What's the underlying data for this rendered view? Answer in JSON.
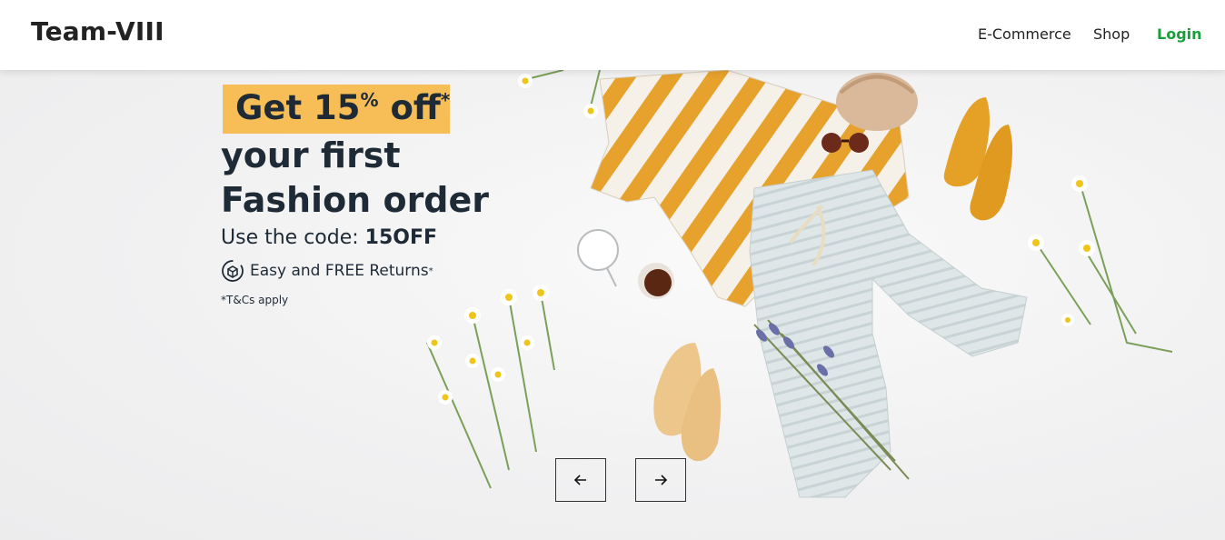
{
  "navbar": {
    "brand": "Team-VIII",
    "links": [
      {
        "label": "E-Commerce"
      },
      {
        "label": "Shop"
      },
      {
        "label": "Login"
      }
    ]
  },
  "hero": {
    "promo_prefix": "Get 15",
    "promo_percent": "%",
    "promo_suffix": " off",
    "promo_star": "*",
    "line2": "your first",
    "line3": "Fashion order",
    "code_prefix": "Use the code: ",
    "code": "15OFF",
    "returns_text": "Easy and FREE Returns",
    "returns_star": "*",
    "terms": "*T&Cs apply",
    "returns_icon": "returns-box-icon"
  },
  "carousel": {
    "prev_icon": "arrow-left-icon",
    "next_icon": "arrow-right-icon"
  },
  "colors": {
    "accent_login": "#1a9e3a",
    "promo_highlight": "#f7be58",
    "text_dark": "#1f2a37"
  }
}
